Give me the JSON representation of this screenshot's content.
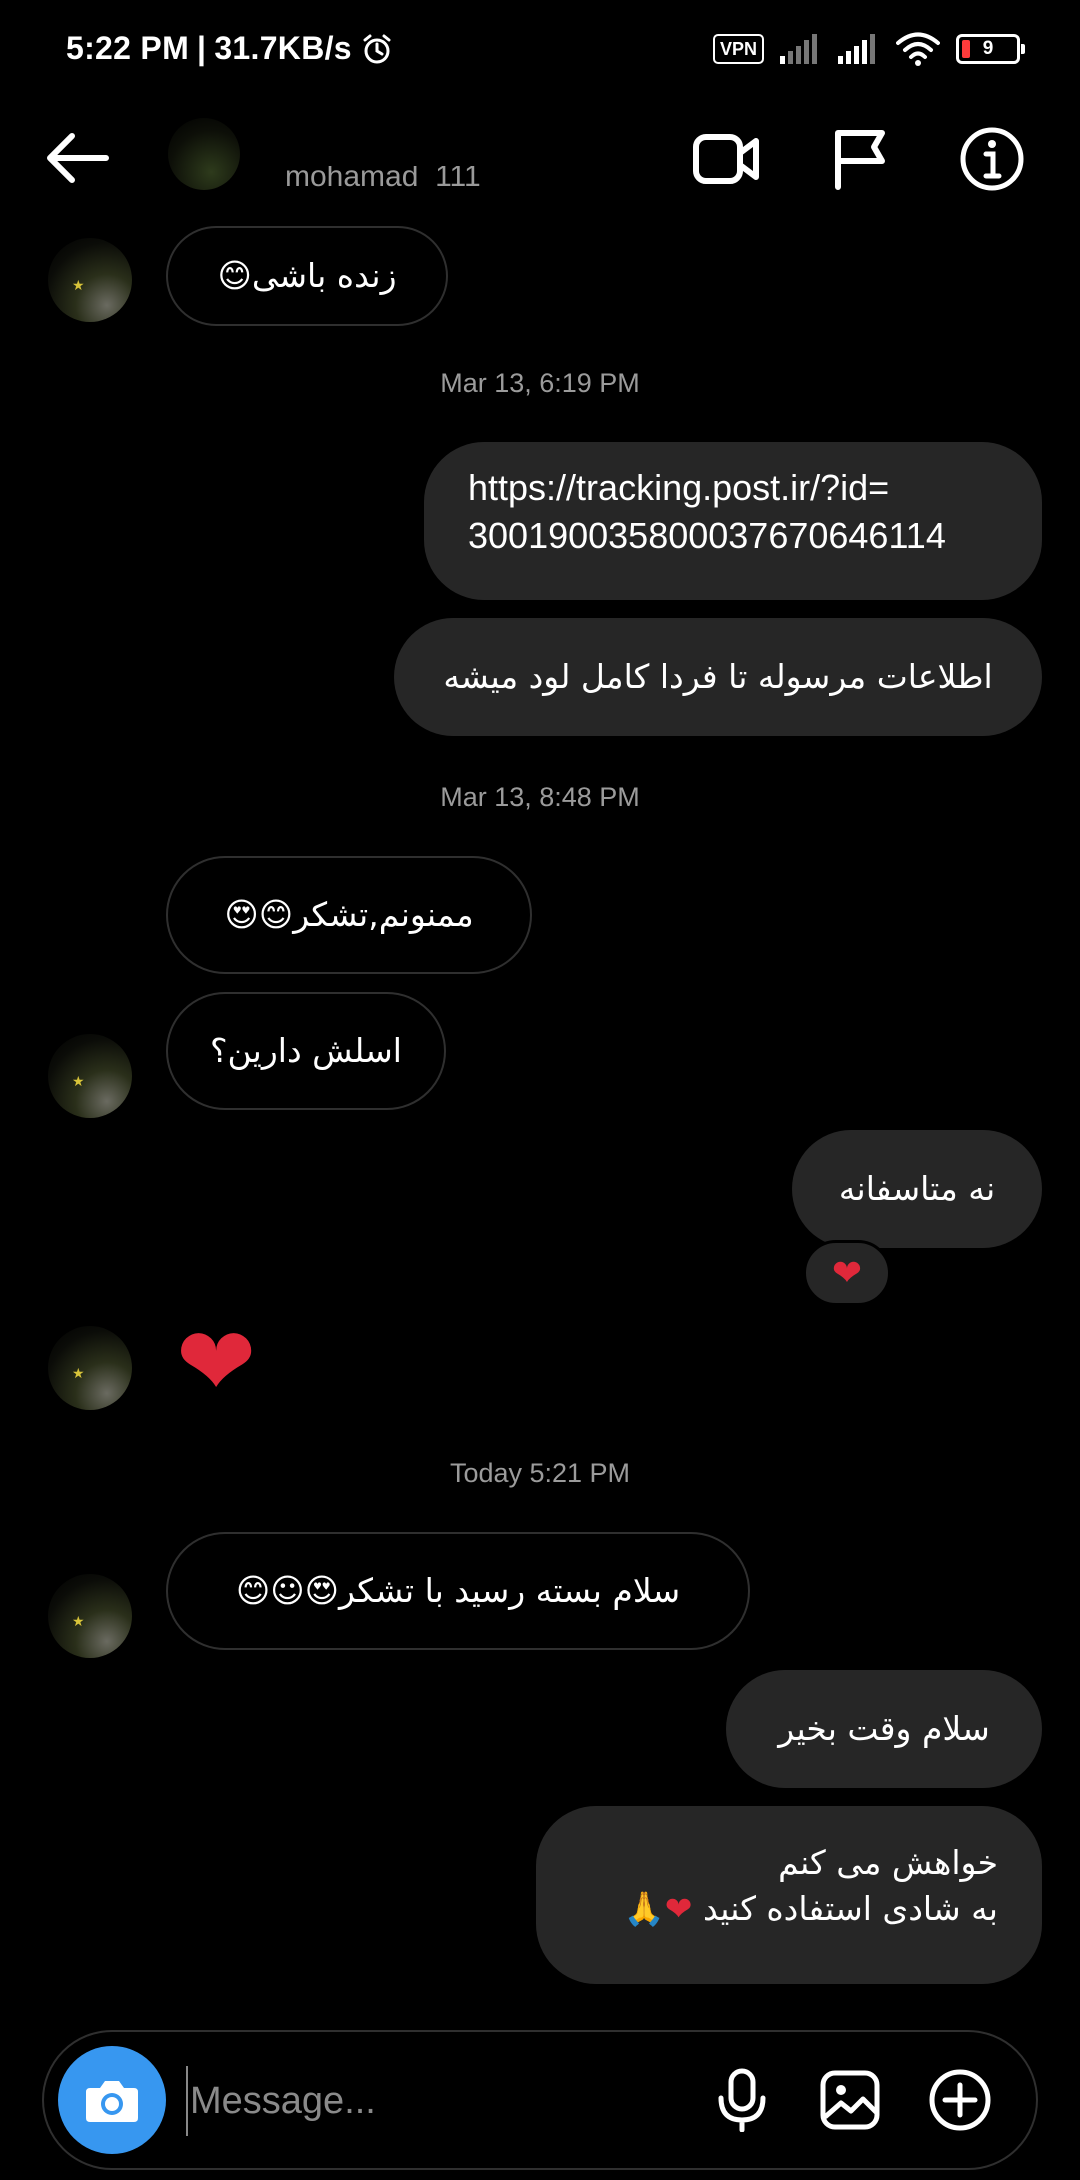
{
  "status_bar": {
    "time": "5:22 PM",
    "separator": "|",
    "speed": "31.7KB/s",
    "vpn": "VPN",
    "battery": "9"
  },
  "header": {
    "username": "mohamad_111"
  },
  "messages": {
    "m1": {
      "text": "زنده باشی",
      "emoji": "😊"
    },
    "ts1": "Mar 13, 6:19 PM",
    "m2": {
      "line1": "https://tracking.post.ir/?id=",
      "line2": "300190035800037670646114"
    },
    "m3": {
      "text": "اطلاعات مرسوله تا فردا کامل لود میشه"
    },
    "ts2": "Mar 13, 8:48 PM",
    "m4": {
      "text": "ممنونم,تشکر",
      "emoji": "😊😍"
    },
    "m5": {
      "text": "اسلش دارین؟"
    },
    "m6": {
      "text": "نه متاسفانه",
      "reaction": "❤"
    },
    "m7": {
      "emoji": "❤"
    },
    "ts3": "Today 5:21 PM",
    "m8": {
      "text": "سلام بسته رسید با تشکر",
      "emoji": "😍☺😊"
    },
    "m9": {
      "text": "سلام وقت بخیر"
    },
    "m10": {
      "line1": "خواهش می کنم",
      "line2": "به شادی استفاده کنید",
      "emoji": "❤🙏"
    }
  },
  "composer": {
    "placeholder": "Message..."
  },
  "icons": {
    "back": "arrow-left-icon",
    "video": "video-camera-icon",
    "flag": "flag-icon",
    "info": "info-icon",
    "camera": "camera-icon",
    "mic": "microphone-icon",
    "gallery": "image-icon",
    "plus": "plus-circle-icon"
  },
  "colors": {
    "background": "#000000",
    "outgoing_bubble": "#262626",
    "incoming_border": "#2f2f2f",
    "accent": "#3797f0",
    "heart": "#e0283a"
  }
}
